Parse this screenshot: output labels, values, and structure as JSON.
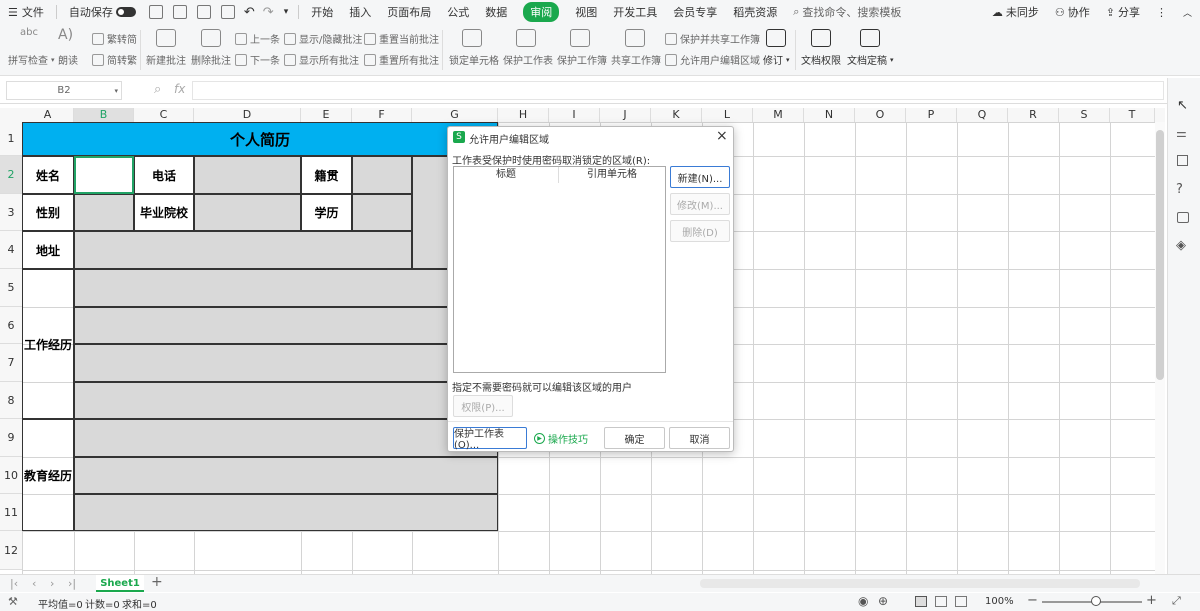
{
  "menubar": {
    "file": "文件",
    "autosave": "自动保存",
    "tabs": [
      "开始",
      "插入",
      "页面布局",
      "公式",
      "数据",
      "审阅",
      "视图",
      "开发工具",
      "会员专享",
      "稻壳资源"
    ],
    "search": "查找命令、搜索模板",
    "sync": "未同步",
    "collab": "协作",
    "share": "分享"
  },
  "ribbon": {
    "spell": "拼写检查",
    "read": "朗读",
    "trad": "繁转简",
    "simp": "简转繁",
    "new_comment": "新建批注",
    "del_comment": "删除批注",
    "prev": "上一条",
    "next": "下一条",
    "show_hide": "显示/隐藏批注",
    "show_all": "显示所有批注",
    "reset_cur": "重置当前批注",
    "reset_all": "重置所有批注",
    "lock_cell": "锁定单元格",
    "protect_sheet": "保护工作表",
    "protect_book": "保护工作簿",
    "share_book": "共享工作簿",
    "protect_share": "保护并共享工作簿",
    "allow_edit": "允许用户编辑区域",
    "revise": "修订",
    "doc_perm": "文档权限",
    "doc_final": "文档定稿"
  },
  "formula": {
    "cellref": "B2",
    "fx": "fx"
  },
  "columns": [
    "A",
    "B",
    "C",
    "D",
    "E",
    "F",
    "G",
    "H",
    "I",
    "J",
    "K",
    "L",
    "M",
    "N",
    "O",
    "P",
    "Q",
    "R",
    "S",
    "T"
  ],
  "rows": [
    "1",
    "2",
    "3",
    "4",
    "5",
    "6",
    "7",
    "8",
    "9",
    "10",
    "11",
    "12"
  ],
  "sheet": {
    "title": "个人简历",
    "name": "姓名",
    "phone": "电话",
    "origin": "籍贯",
    "gender": "性别",
    "school": "毕业院校",
    "degree": "学历",
    "address": "地址",
    "work": "工作经历",
    "edu": "教育经历"
  },
  "dialog": {
    "title": "允许用户编辑区域",
    "desc": "工作表受保护时使用密码取消锁定的区域(R):",
    "col_title": "标题",
    "col_ref": "引用单元格",
    "new": "新建(N)...",
    "modify": "修改(M)...",
    "delete": "删除(D)",
    "nopw": "指定不需要密码就可以编辑该区域的用户",
    "perm": "权限(P)...",
    "protect": "保护工作表(O)...",
    "tips": "操作技巧",
    "ok": "确定",
    "cancel": "取消"
  },
  "tabs": {
    "sheet1": "Sheet1",
    "add": "+"
  },
  "status": {
    "avg": "平均值=0",
    "count": "计数=0",
    "sum": "求和=0",
    "zoom": "100%"
  },
  "colors": {
    "accent": "#1aa84d",
    "header_blue": "#00b0f0",
    "cell_gray": "#d9d9d9"
  }
}
